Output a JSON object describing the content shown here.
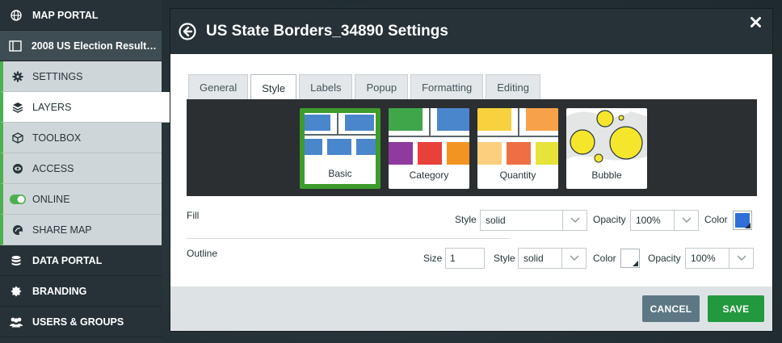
{
  "sidebar": {
    "items": [
      {
        "label": "MAP PORTAL",
        "icon": "globe-icon"
      },
      {
        "label": "2008 US Election Results...",
        "icon": "map-book-icon"
      },
      {
        "label": "SETTINGS",
        "icon": "gear-icon"
      },
      {
        "label": "LAYERS",
        "icon": "layers-icon"
      },
      {
        "label": "TOOLBOX",
        "icon": "box-icon"
      },
      {
        "label": "ACCESS",
        "icon": "eye-globe-icon"
      },
      {
        "label": "ONLINE",
        "icon": "toggle-icon"
      },
      {
        "label": "SHARE MAP",
        "icon": "share-globe-icon"
      },
      {
        "label": "DATA PORTAL",
        "icon": "database-icon"
      },
      {
        "label": "BRANDING",
        "icon": "badge-icon"
      },
      {
        "label": "USERS & GROUPS",
        "icon": "users-icon"
      }
    ],
    "active": "LAYERS"
  },
  "modal": {
    "title": "US State Borders_34890 Settings",
    "close_icon": "close-icon",
    "back_icon": "back-arrow-icon",
    "tabs": [
      {
        "label": "General"
      },
      {
        "label": "Style"
      },
      {
        "label": "Labels"
      },
      {
        "label": "Popup"
      },
      {
        "label": "Formatting"
      },
      {
        "label": "Editing"
      }
    ],
    "active_tab": "Style",
    "style_types": [
      {
        "label": "Basic"
      },
      {
        "label": "Category"
      },
      {
        "label": "Quantity"
      },
      {
        "label": "Bubble"
      }
    ],
    "selected_style": "Basic",
    "fill": {
      "label": "Fill",
      "style_label": "Style",
      "style_value": "solid",
      "opacity_label": "Opacity",
      "opacity_value": "100%",
      "color_label": "Color",
      "color": "#2f6fd8"
    },
    "outline": {
      "label": "Outline",
      "size_label": "Size",
      "size_value": "1",
      "style_label": "Style",
      "style_value": "solid",
      "color_label": "Color",
      "color": "#ffffff",
      "opacity_label": "Opacity",
      "opacity_value": "100%"
    },
    "buttons": {
      "cancel": "CANCEL",
      "save": "SAVE"
    }
  },
  "colors": {
    "sidebar_bg": "#263237",
    "accent_green": "#4caf50",
    "save_green": "#23993f",
    "cancel_slate": "#5d7784",
    "selected_border": "#3e9c2c"
  }
}
